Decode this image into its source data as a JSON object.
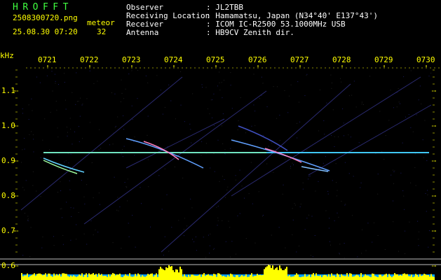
{
  "header": {
    "logo": "HROFFT",
    "filename": "2508300720.png",
    "datetime": "25.08.30 07:20",
    "category_label": "meteor",
    "count": "32",
    "info": [
      {
        "label": "Observer",
        "value": ": JL2TBB"
      },
      {
        "label": "Receiving Location",
        "value": ": Hamamatsu, Japan (N34°40' E137°43')"
      },
      {
        "label": "Receiver",
        "value": ": ICOM IC-R2500 53.1000MHz USB"
      },
      {
        "label": "Antenna",
        "value": ": HB9CV Zenith dir."
      }
    ]
  },
  "axis": {
    "unit": "kHz",
    "x_ticks": [
      "0721",
      "0722",
      "0723",
      "0724",
      "0725",
      "0726",
      "0727",
      "0728",
      "0729",
      "0730"
    ],
    "y_ticks": [
      "1.1",
      "1.0",
      "0.9",
      "0.8",
      "0.7",
      "0.6"
    ]
  },
  "colors": {
    "background": "#000000",
    "axis_text": "#ffff00",
    "logo": "#40ff40",
    "info_text": "#ffffff",
    "carrier": "#40c8ff",
    "level_bar": "#ffff00",
    "level_base": "#00a0ff"
  }
}
